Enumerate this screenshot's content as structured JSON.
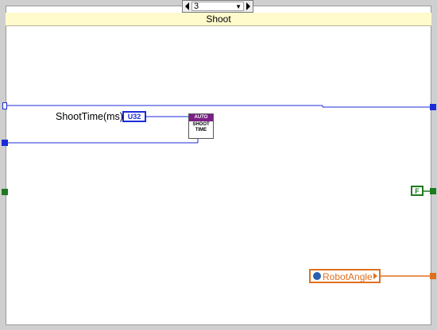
{
  "case_structure": {
    "selector_value": "3",
    "case_title": "Shoot"
  },
  "nodes": {
    "shoot_time_label": "ShootTime(ms)",
    "u32_label": "U32",
    "subvi_top": "AUTO",
    "subvi_line1": "SHOOT",
    "subvi_line2": "TIME",
    "bool_const": "F",
    "robot_angle_label": "RobotAngle"
  },
  "colors": {
    "int_wire": "#1c2bd8",
    "bool_wire": "#1e7a1e",
    "ref_wire": "#e07020",
    "case_title_bg": "#fffbcc",
    "subvi_banner": "#7c1f86"
  }
}
